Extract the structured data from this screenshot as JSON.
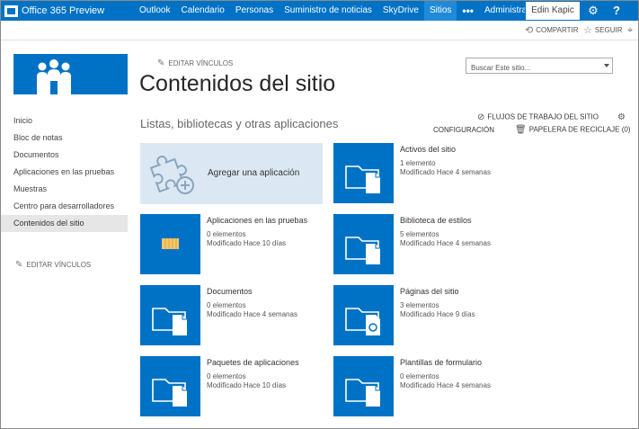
{
  "suite_bar": {
    "brand": "Office 365 Preview",
    "nav": [
      "Outlook",
      "Calendario",
      "Personas",
      "Suministro de noticias",
      "SkyDrive",
      "Sitios"
    ],
    "active_nav": "Sitios",
    "more": "•••",
    "admin": "Administrador",
    "user": "Edin Kapic",
    "icons": [
      "gear-icon",
      "help-icon"
    ]
  },
  "ribbon": {
    "share": "COMPARTIR",
    "follow": "SEGUIR",
    "icons": [
      "share-icon",
      "star-icon",
      "focus-icon"
    ]
  },
  "header": {
    "edit_links": "EDITAR VÍNCULOS",
    "title": "Contenidos del sitio",
    "search_placeholder": "Buscar Este sitio..."
  },
  "left_nav": {
    "items": [
      "Inicio",
      "Bloc de notas",
      "Documentos",
      "Aplicaciones en las pruebas",
      "Muestras",
      "Centro para desarrolladores",
      "Contenidos del sitio"
    ],
    "selected": "Contenidos del sitio",
    "edit_links": "EDITAR VÍNCULOS"
  },
  "section": {
    "title": "Listas, bibliotecas y otras aplicaciones",
    "workflows": "FLUJOS DE TRABAJO DEL SITIO",
    "settings": "CONFIGURACIÓN",
    "recycle_bin": "PAPELERA DE RECICLAJE (0)"
  },
  "add_app": {
    "label": "Agregar una aplicación"
  },
  "apps": [
    {
      "name": "Activos del sitio",
      "count": "1 elemento",
      "modified": "Modificado Hace 4 semanas",
      "icon": "folder-doc-icon"
    },
    {
      "name": "Aplicaciones en las pruebas",
      "count": "0 elementos",
      "modified": "Modificado Hace 10 días",
      "icon": "app-catalog-icon"
    },
    {
      "name": "Biblioteca de estilos",
      "count": "5 elementos",
      "modified": "Modificado Hace 4 semanas",
      "icon": "folder-doc-icon"
    },
    {
      "name": "Documentos",
      "count": "0 elementos",
      "modified": "Modificado Hace 4 semanas",
      "icon": "folder-doc-icon"
    },
    {
      "name": "Páginas del sitio",
      "count": "3 elementos",
      "modified": "Modificado Hace 9 días",
      "icon": "folder-pages-icon"
    },
    {
      "name": "Paquetes de aplicaciones",
      "count": "0 elementos",
      "modified": "Modificado Hace 10 días",
      "icon": "folder-doc-icon"
    },
    {
      "name": "Plantillas de formulario",
      "count": "0 elementos",
      "modified": "Modificado Hace 4 semanas",
      "icon": "folder-doc-icon"
    }
  ],
  "colors": {
    "brand": "#0072c6",
    "tile": "#0072c6",
    "add_app_bg": "#dbe8f4",
    "selected_nav": "#e6e6e6"
  }
}
